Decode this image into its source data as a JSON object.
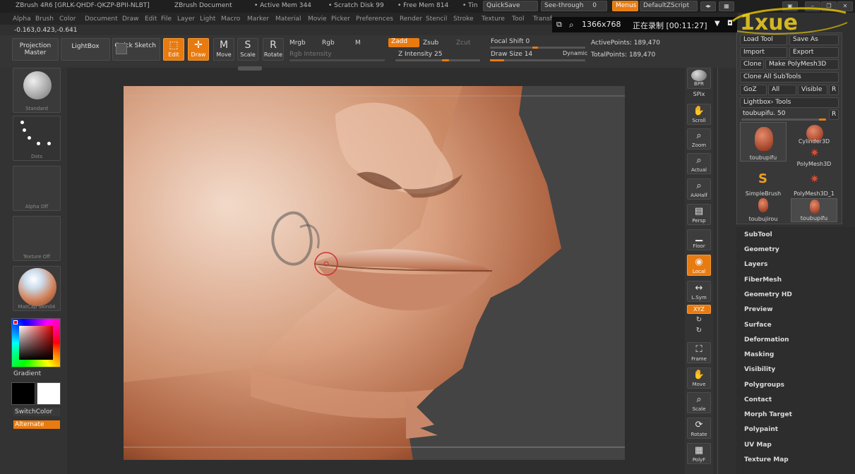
{
  "title_bar": {
    "app": "ZBrush 4R6 [GRLK-QHDF-QKZP-BPII-NLBT]",
    "document": "ZBrush Document",
    "active_mem": "• Active Mem 344",
    "scratch_disk": "• Scratch Disk 99",
    "free_mem": "• Free Mem 814",
    "time": "• Tin",
    "quicksave": "QuickSave",
    "see_through": "See-through",
    "see_through_value": "0",
    "menus": "Menus",
    "default_zscript": "DefaultZScript"
  },
  "menu_bar": [
    "Alpha",
    "Brush",
    "Color",
    "Document",
    "Draw",
    "Edit",
    "File",
    "Layer",
    "Light",
    "Macro",
    "Marker",
    "Material",
    "Movie",
    "Picker",
    "Preferences",
    "Render",
    "Stencil",
    "Stroke",
    "Texture",
    "Tool",
    "Transf"
  ],
  "recorder": {
    "resolution": "1366x768",
    "status": "正在录制 [00:11:27]"
  },
  "logo": {
    "text": "1xue"
  },
  "coords": "-0.163,0.423,-0.641",
  "toolbar": {
    "projection_master": "Projection Master",
    "lightbox": "LightBox",
    "quick_sketch": "Quick Sketch",
    "edit": "Edit",
    "draw": "Draw",
    "move": "Move",
    "scale": "Scale",
    "rotate": "Rotate",
    "mrgb": "Mrgb",
    "rgb": "Rgb",
    "m": "M",
    "rgb_intensity": "Rgb Intensity",
    "zadd": "Zadd",
    "zsub": "Zsub",
    "zcut": "Zcut",
    "z_intensity": "Z Intensity 25",
    "z_intensity_value": 25,
    "focal_shift": "Focal Shift 0",
    "focal_shift_value": 0,
    "draw_size": "Draw Size 14",
    "draw_size_value": 14,
    "dynamic": "Dynamic",
    "active_points": "ActivePoints: 189,470",
    "total_points": "TotalPoints: 189,470"
  },
  "left_shelf": {
    "brush": "Standard",
    "stroke": "Dots",
    "alpha": "Alpha Off",
    "texture": "Texture Off",
    "material": "MatCap Skin04",
    "gradient": "Gradient",
    "switch_color": "SwitchColor",
    "alternate": "Alternate"
  },
  "right_shelf": {
    "bpr": "BPR",
    "spix": "SPix",
    "scroll": "Scroll",
    "zoom": "Zoom",
    "actual": "Actual",
    "aahalf": "AAHalf",
    "persp": "Persp",
    "floor": "Floor",
    "local": "Local",
    "lsym": "L.Sym",
    "xyz": "XYZ",
    "frame": "Frame",
    "move": "Move",
    "scale": "Scale",
    "rotate": "Rotate",
    "polyf": "PolyF"
  },
  "tool_panel": {
    "load_tool": "Load Tool",
    "save_as": "Save As",
    "import": "Import",
    "export": "Export",
    "clone": "Clone",
    "make_polymesh": "Make PolyMesh3D",
    "clone_all": "Clone All SubTools",
    "goz": "GoZ",
    "all": "All",
    "visible": "Visible",
    "r": "R",
    "lightbox_tools": "Lightbox› Tools",
    "current_tool": "toubupifu. 50",
    "current_tool_value": 50,
    "thumbs": [
      "toubupifu",
      "Cylinder3D",
      "PolyMesh3D",
      "SimpleBrush",
      "PolyMesh3D_1",
      "toubujirou",
      "toubupifu"
    ]
  },
  "menu_list": [
    "SubTool",
    "Geometry",
    "Layers",
    "FiberMesh",
    "Geometry HD",
    "Preview",
    "Surface",
    "Deformation",
    "Masking",
    "Visibility",
    "Polygroups",
    "Contact",
    "Morph Target",
    "Polypaint",
    "UV Map",
    "Texture Map"
  ],
  "colors": {
    "accent": "#e87b10",
    "panel": "#383838",
    "skin": "#c8845e"
  }
}
